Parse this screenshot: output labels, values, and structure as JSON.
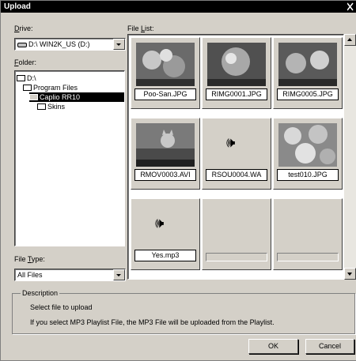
{
  "window": {
    "title": "Upload"
  },
  "drive": {
    "label": "Drive:",
    "accel": "D",
    "rest": "rive:",
    "value": "D:\\ WIN2K_US (D:)"
  },
  "folder": {
    "accel": "F",
    "rest": "older:",
    "tree": [
      {
        "label": "D:\\",
        "selected": false
      },
      {
        "label": "Program Files",
        "selected": false
      },
      {
        "label": "Caplio RR10",
        "selected": true
      },
      {
        "label": "Skins",
        "selected": false
      }
    ]
  },
  "file_type": {
    "pre": "File ",
    "accel": "T",
    "rest": "ype:",
    "value": "All Files"
  },
  "file_list": {
    "pre": "File ",
    "accel": "L",
    "rest": "ist:",
    "items": [
      {
        "name": "Poo-San.JPG",
        "kind": "image",
        "icon": "photo-food-icon"
      },
      {
        "name": "RIMG0001.JPG",
        "kind": "image",
        "icon": "photo-food-icon"
      },
      {
        "name": "RIMG0005.JPG",
        "kind": "image",
        "icon": "photo-food-icon"
      },
      {
        "name": "RMOV0003.AVI",
        "kind": "video",
        "icon": "video-cat-icon"
      },
      {
        "name": "RSOU0004.WA",
        "kind": "audio",
        "icon": "speaker-icon"
      },
      {
        "name": "test010.JPG",
        "kind": "image",
        "icon": "photo-roses-icon"
      },
      {
        "name": "Yes.mp3",
        "kind": "audio",
        "icon": "speaker-icon"
      },
      {
        "name": "",
        "kind": "empty",
        "icon": ""
      },
      {
        "name": "",
        "kind": "empty",
        "icon": ""
      }
    ]
  },
  "description": {
    "title": "Description",
    "line1": "Select file to upload",
    "line2": "If you select MP3 Playlist File, the MP3 File will be uploaded from the Playlist."
  },
  "buttons": {
    "ok": "OK",
    "cancel": "Cancel"
  },
  "colors": {
    "dialog_bg": "#d4d0c8",
    "selection": "#000000"
  }
}
